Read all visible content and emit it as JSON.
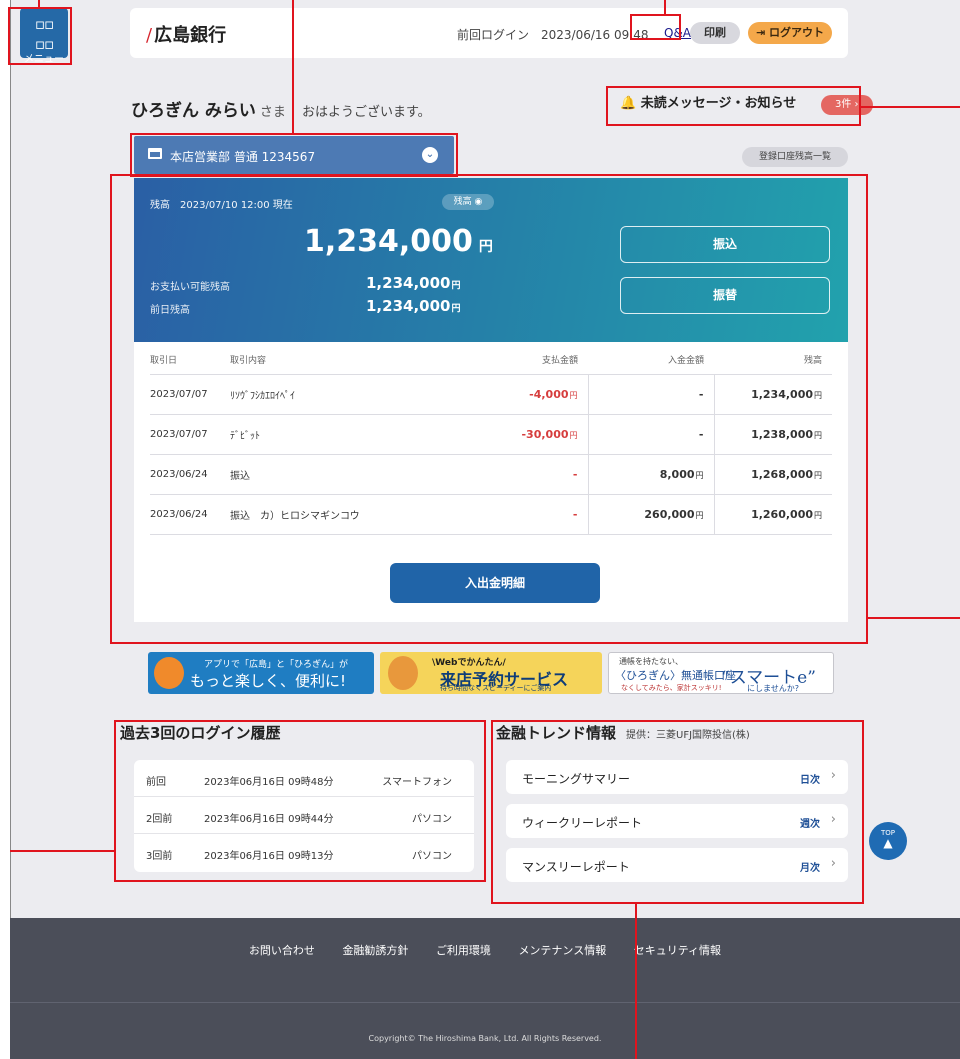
{
  "menu": {
    "icon": "grid-icon",
    "label": "メニュー"
  },
  "header": {
    "brand": "広島銀行",
    "last_login": "前回ログイン　2023/06/16 09:48",
    "qa": "Q&A",
    "print": "印刷",
    "logout": "ログアウト"
  },
  "greeting": {
    "name": "ひろぎん みらい",
    "sama": "さま",
    "hello": "おはようございます。"
  },
  "notice": {
    "label": "未読メッセージ・お知らせ",
    "count": "3件"
  },
  "account": {
    "label": "本店営業部 普通 1234567"
  },
  "registered_balance": "登録口座残高一覧",
  "balance": {
    "as_of": "残高　2023/07/10 12:00 現在",
    "toggle": "残高",
    "amount": "1,234,000",
    "yen": "円",
    "available_label": "お支払い可能残高",
    "available_value": "1,234,000",
    "prev_label": "前日残高",
    "prev_value": "1,234,000",
    "yen_small": "円",
    "transfer": "振込",
    "furikae": "振替"
  },
  "table": {
    "headers": {
      "date": "取引日",
      "desc": "取引内容",
      "out": "支払金額",
      "in": "入金金額",
      "bal": "残高"
    },
    "rows": [
      {
        "date": "2023/07/07",
        "desc": "ﾘｿｳﾞﾌｼｶｴﾛｲﾍﾟｲ",
        "out": "-4,000",
        "in": "-",
        "bal": "1,234,000"
      },
      {
        "date": "2023/07/07",
        "desc": "ﾃﾞﾋﾞｯﾄ",
        "out": "-30,000",
        "in": "-",
        "bal": "1,238,000"
      },
      {
        "date": "2023/06/24",
        "desc": "振込",
        "out": "-",
        "in": "8,000",
        "bal": "1,268,000"
      },
      {
        "date": "2023/06/24",
        "desc": "振込　カ）ヒロシマギンコウ",
        "out": "-",
        "in": "260,000",
        "bal": "1,260,000"
      }
    ],
    "yen": "円"
  },
  "detail_button": "入出金明細",
  "banners": {
    "app": {
      "line1": "アプリで「広島」と「ひろぎん」が",
      "line2": "もっと楽しく、便利に!"
    },
    "visit": {
      "line1": "\\Webでかんたん/",
      "line2": "来店予約サービス",
      "line3": "待ち時間なくスピーディーにご案内"
    },
    "smart": {
      "line1": "通帳を持たない、",
      "line2": "〈ひろぎん〉無通帳口座",
      "line2b": "“スマートe”",
      "line3": "なくしてみたら、家計スッキリ!",
      "line4": "にしませんか?"
    }
  },
  "login_history": {
    "title": "過去3回のログイン履歴",
    "rows": [
      {
        "when": "前回",
        "datetime": "2023年06月16日 09時48分",
        "device": "スマートフォン"
      },
      {
        "when": "2回前",
        "datetime": "2023年06月16日 09時44分",
        "device": "パソコン"
      },
      {
        "when": "3回前",
        "datetime": "2023年06月16日 09時13分",
        "device": "パソコン"
      }
    ]
  },
  "trend": {
    "title": "金融トレンド情報",
    "provider": "提供：三菱UFJ国際投信(株)",
    "items": [
      {
        "name": "モーニングサマリー",
        "freq": "日次"
      },
      {
        "name": "ウィークリーレポート",
        "freq": "週次"
      },
      {
        "name": "マンスリーレポート",
        "freq": "月次"
      }
    ]
  },
  "footer": {
    "links": [
      "お問い合わせ",
      "金融勧誘方針",
      "ご利用環境",
      "メンテナンス情報",
      "セキュリティ情報"
    ],
    "copyright": "Copyright© The Hiroshima Bank, Ltd. All Rights Reserved.",
    "top": "TOP"
  },
  "colors": {
    "brand_blue": "#2569a7",
    "annotation_red": "#e0141e",
    "negative": "#d63d3d",
    "logout_orange": "#f4a84a"
  }
}
